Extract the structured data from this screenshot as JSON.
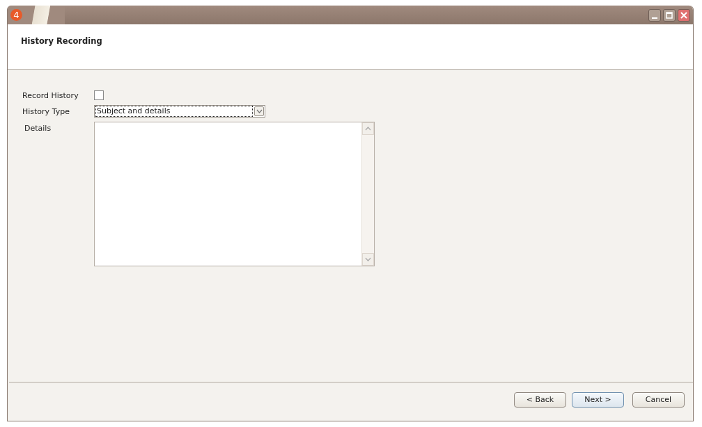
{
  "window": {
    "logo": "4"
  },
  "header": {
    "title": "History Recording"
  },
  "form": {
    "record_history": {
      "label": "Record History",
      "checked": false
    },
    "history_type": {
      "label": "History Type",
      "value": "Subject and details"
    },
    "details": {
      "label": "Details"
    }
  },
  "buttons": [
    {
      "label": "< Back",
      "default": false
    },
    {
      "label": "Next >",
      "default": true
    },
    {
      "label": "Cancel",
      "default": false
    }
  ]
}
